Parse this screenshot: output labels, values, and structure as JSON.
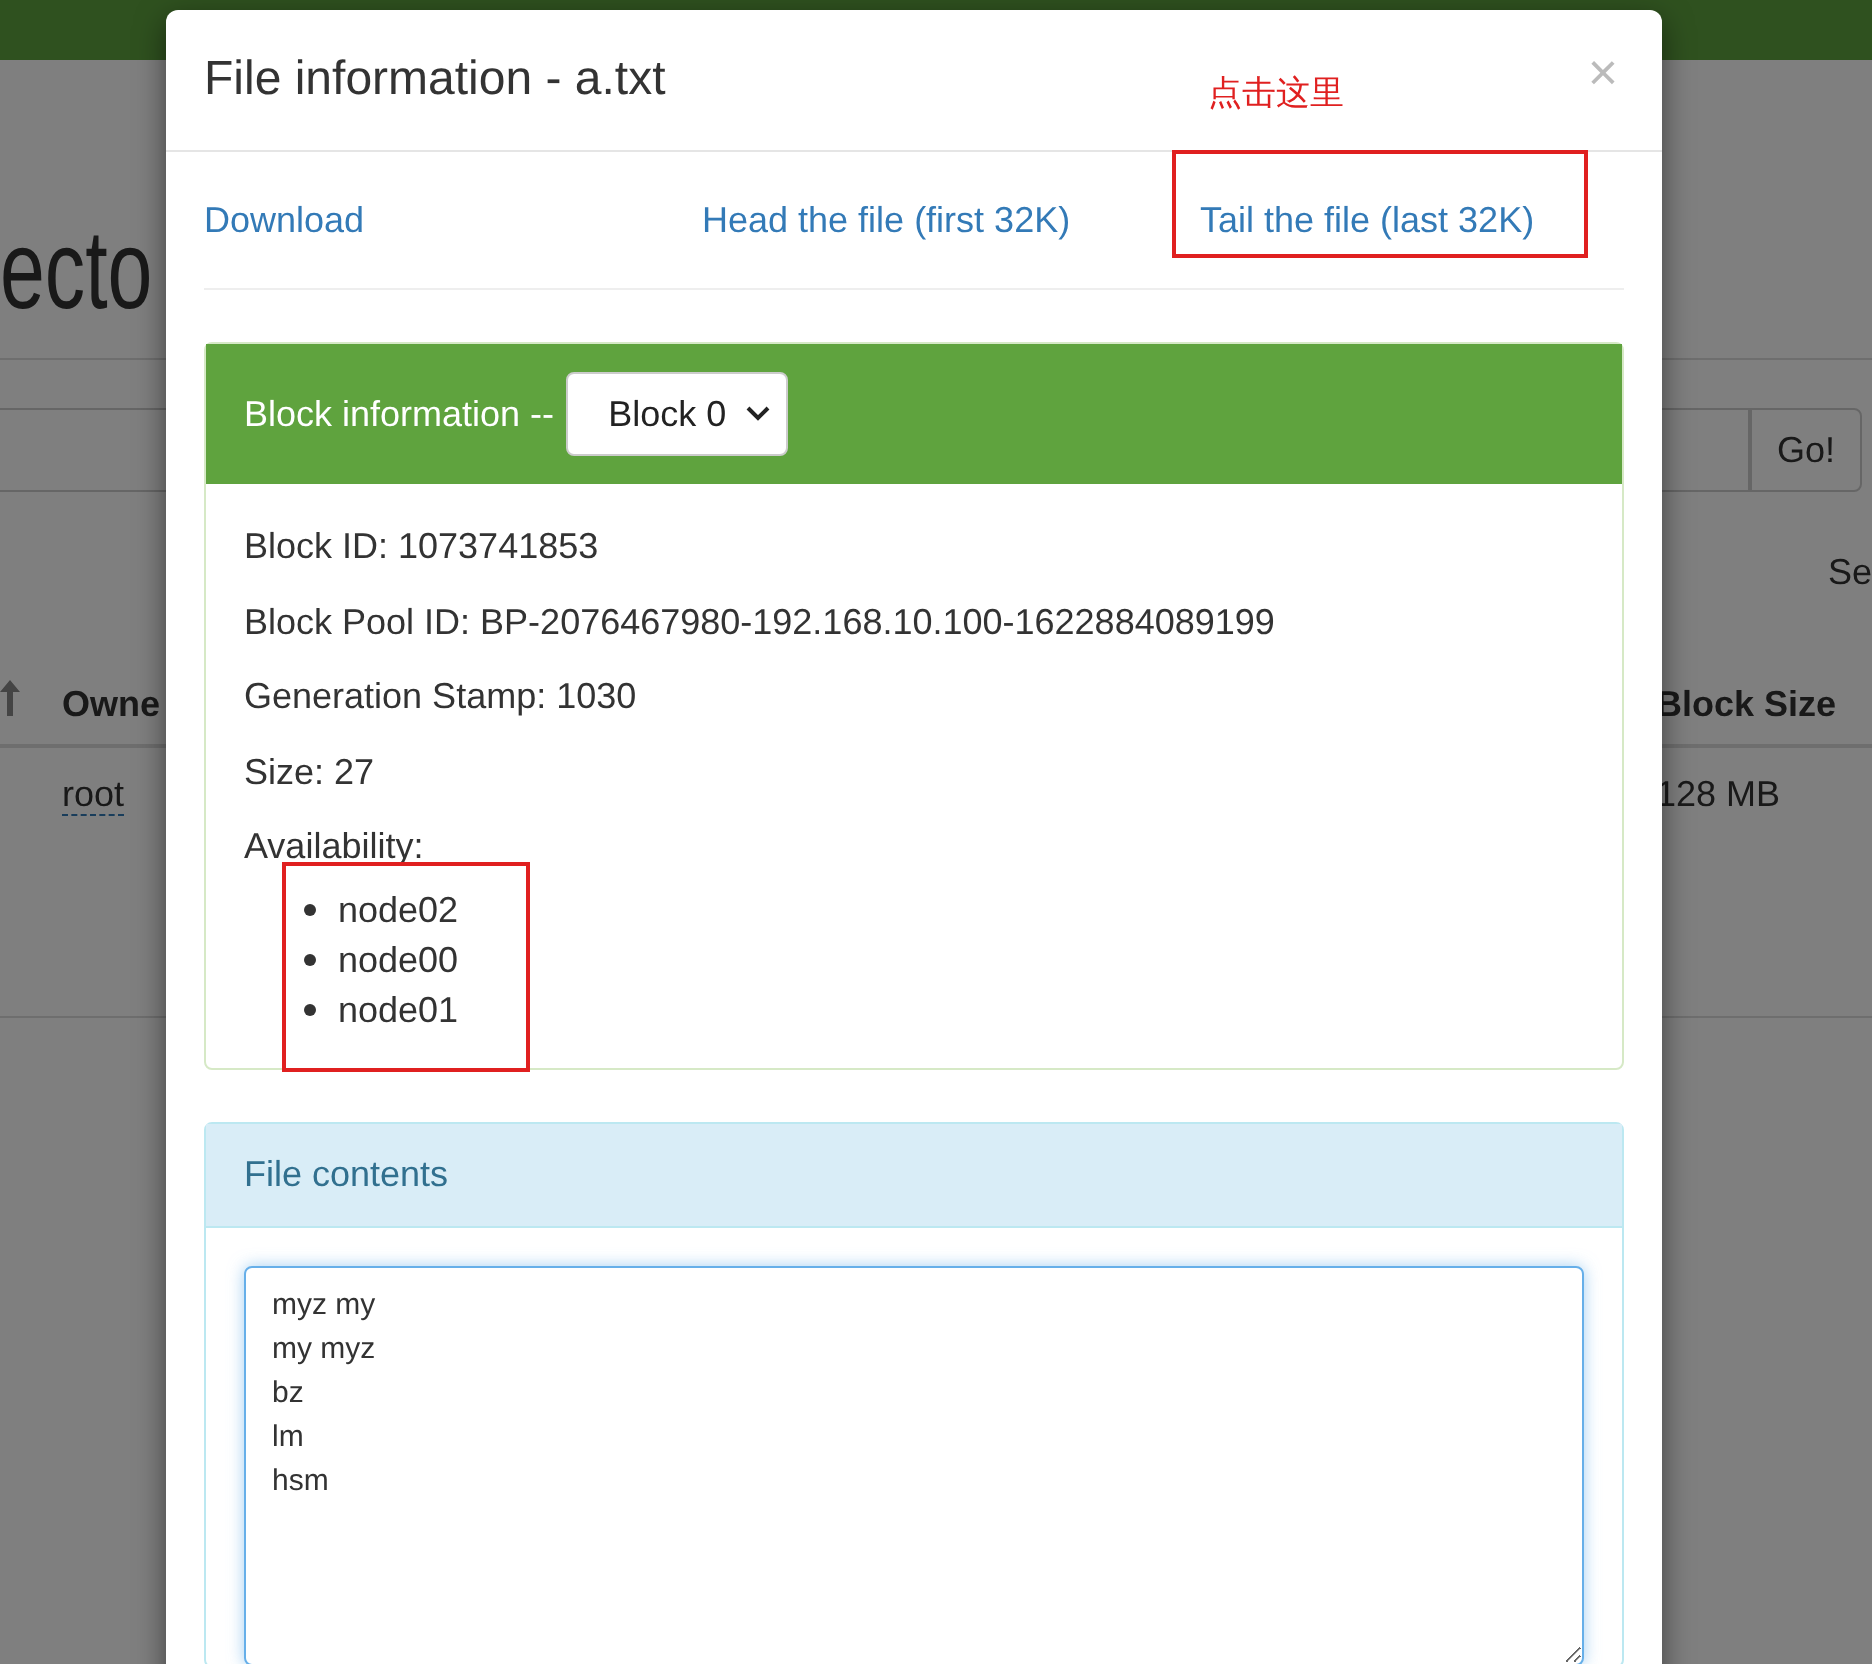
{
  "background": {
    "heading": "ecto",
    "go_button": "Go!",
    "search_label": "Se",
    "columns": [
      "Owne",
      "Block Size"
    ],
    "row": [
      "root",
      "128 MB"
    ]
  },
  "modal": {
    "title": "File information - a.txt",
    "close": "×",
    "annotation": "点击这里",
    "links": [
      {
        "label": "Download",
        "highlighted": false
      },
      {
        "label": "Head the file (first 32K)",
        "highlighted": false
      },
      {
        "label": "Tail the file (last 32K)",
        "highlighted": true
      }
    ],
    "block_panel": {
      "label": "Block information --",
      "select": "Block 0",
      "fields": [
        "Block ID: 1073741853",
        "Block Pool ID: BP-2076467980-192.168.10.100-1622884089199",
        "Generation Stamp: 1030",
        "Size: 27"
      ],
      "availability_label": "Availability:",
      "nodes": [
        "node02",
        "node00",
        "node01"
      ],
      "nodes_highlighted": true
    },
    "contents_panel": {
      "title": "File contents",
      "text": "myz my\nmy myz\nbz\nlm\nhsm"
    }
  }
}
